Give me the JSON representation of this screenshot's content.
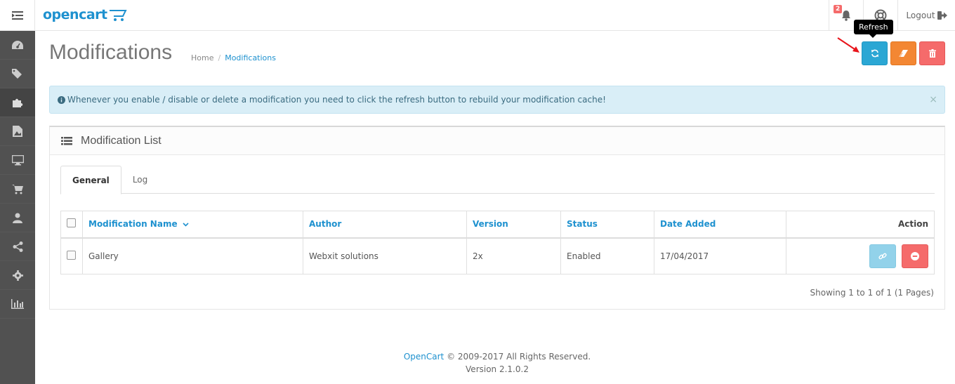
{
  "header": {
    "logo_text": "opencart",
    "notifications_count": "2",
    "logout_label": "Logout"
  },
  "sidebar": {
    "items": [
      {
        "icon": "dashboard-icon"
      },
      {
        "icon": "tags-icon"
      },
      {
        "icon": "puzzle-icon"
      },
      {
        "icon": "image-icon"
      },
      {
        "icon": "desktop-icon"
      },
      {
        "icon": "cart-icon"
      },
      {
        "icon": "user-icon"
      },
      {
        "icon": "share-icon"
      },
      {
        "icon": "gear-icon"
      },
      {
        "icon": "bar-chart-icon"
      }
    ]
  },
  "page": {
    "title": "Modifications",
    "breadcrumb": [
      "Home",
      "Modifications"
    ],
    "tooltip": "Refresh"
  },
  "alert": {
    "text": "Whenever you enable / disable or delete a modification you need to click the refresh button to rebuild your modification cache!",
    "close": "×"
  },
  "panel": {
    "title": "Modification List",
    "tabs": [
      "General",
      "Log"
    ]
  },
  "table": {
    "headers": [
      "Modification Name",
      "Author",
      "Version",
      "Status",
      "Date Added",
      "Action"
    ],
    "rows": [
      {
        "name": "Gallery",
        "author": "Webxit solutions",
        "version": "2x",
        "status": "Enabled",
        "date": "17/04/2017"
      }
    ],
    "showing": "Showing 1 to 1 of 1 (1 Pages)"
  },
  "footer": {
    "link": "OpenCart",
    "copyright": "© 2009-2017 All Rights Reserved.",
    "version": "Version 2.1.0.2"
  },
  "colors": {
    "brand": "#1e91cf",
    "refresh": "#2ba7d4",
    "clear": "#f38733",
    "delete": "#f56b6b",
    "sidebar": "#515151"
  }
}
